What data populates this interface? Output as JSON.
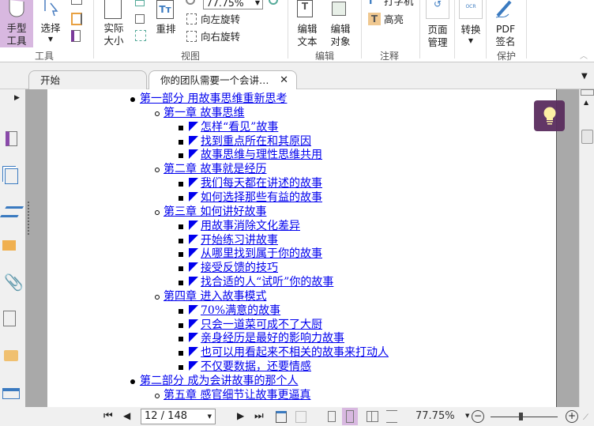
{
  "ribbon": {
    "hand_tool": "手型\n工具",
    "select": "选择",
    "actual_size": "实际\n大小",
    "reflow": "重排",
    "zoom_value": "77.75%",
    "rotate_left": "向左旋转",
    "rotate_right": "向右旋转",
    "edit_text": "编辑\n文本",
    "edit_object": "编辑\n对象",
    "typewriter": "打字机",
    "highlight": "高亮",
    "page_manage": "页面\n管理",
    "convert": "转换",
    "pdf_sign": "PDF\n签名",
    "groups": {
      "tools": "工具",
      "view": "视图",
      "edit": "编辑",
      "annotate": "注释",
      "protect": "保护"
    }
  },
  "tabs": [
    {
      "label": "开始"
    },
    {
      "label": "你的团队需要一个会讲…"
    }
  ],
  "outline": [
    {
      "level": 0,
      "text": "第一部分 用故事思维重新思考"
    },
    {
      "level": 1,
      "text": "第一章 故事思维"
    },
    {
      "level": 2,
      "text": "怎样“看见”故事"
    },
    {
      "level": 2,
      "text": "找到重点所在和其原因"
    },
    {
      "level": 2,
      "text": "故事思维与理性思维共用"
    },
    {
      "level": 1,
      "text": "第二章 故事就是经历"
    },
    {
      "level": 2,
      "text": "我们每天都在讲述的故事"
    },
    {
      "level": 2,
      "text": "如何选择那些有益的故事"
    },
    {
      "level": 1,
      "text": "第三章 如何讲好故事"
    },
    {
      "level": 2,
      "text": "用故事消除文化差异"
    },
    {
      "level": 2,
      "text": "开始练习讲故事"
    },
    {
      "level": 2,
      "text": "从哪里找到属于你的故事"
    },
    {
      "level": 2,
      "text": "接受反馈的技巧"
    },
    {
      "level": 2,
      "text": "找合适的人“试听”你的故事"
    },
    {
      "level": 1,
      "text": "第四章 进入故事模式"
    },
    {
      "level": 2,
      "text": "70%满意的故事"
    },
    {
      "level": 2,
      "text": "只会一道菜可成不了大厨"
    },
    {
      "level": 2,
      "text": "亲身经历是最好的影响力故事"
    },
    {
      "level": 2,
      "text": "也可以用看起来不相关的故事来打动人"
    },
    {
      "level": 2,
      "text": "不仅要数据，还要情感"
    },
    {
      "level": 0,
      "text": "第二部分 成为会讲故事的那个人"
    },
    {
      "level": 1,
      "text": "第五章 感官细节让故事更逼真"
    }
  ],
  "status": {
    "page_input": "12 / 148",
    "zoom": "77.75%",
    "zoom_slider_fraction": 0.45
  },
  "colors": {
    "accent": "#d8b8e0",
    "link": "#0000ee",
    "tip": "#5a2d5e"
  }
}
